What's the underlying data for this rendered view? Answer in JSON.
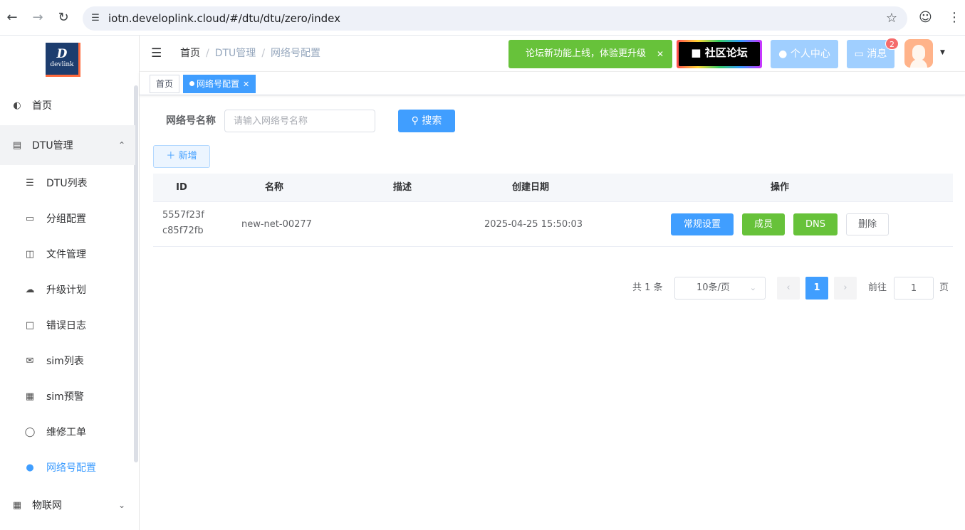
{
  "browser": {
    "url": "iotn.developlink.cloud/#/dtu/dtu/zero/index"
  },
  "logo": {
    "letter": "D",
    "text": "devlink"
  },
  "sidebar": {
    "items": [
      {
        "label": "首页",
        "icon": "dashboard-icon"
      },
      {
        "label": "DTU管理",
        "icon": "server-icon",
        "expanded": true
      },
      {
        "label": "DTU列表",
        "icon": "list-icon"
      },
      {
        "label": "分组配置",
        "icon": "monitor-icon"
      },
      {
        "label": "文件管理",
        "icon": "columns-icon"
      },
      {
        "label": "升级计划",
        "icon": "cloud-upload-icon"
      },
      {
        "label": "错误日志",
        "icon": "log-icon"
      },
      {
        "label": "sim列表",
        "icon": "mail-icon"
      },
      {
        "label": "sim预警",
        "icon": "chart-icon"
      },
      {
        "label": "维修工单",
        "icon": "shield-icon"
      },
      {
        "label": "网络号配置",
        "icon": "user-icon",
        "active": true
      },
      {
        "label": "物联网",
        "icon": "grid-icon"
      }
    ]
  },
  "header": {
    "breadcrumb": [
      "首页",
      "DTU管理",
      "网络号配置"
    ],
    "notice": "论坛新功能上线，体验更升级",
    "forum_label": "社区论坛",
    "profile_label": "个人中心",
    "messages_label": "消息",
    "messages_count": "2"
  },
  "tags": [
    {
      "label": "首页"
    },
    {
      "label": "网络号配置",
      "active": true
    }
  ],
  "search": {
    "label": "网络号名称",
    "placeholder": "请输入网络号名称",
    "button": "搜索"
  },
  "add_button": "新增",
  "table": {
    "columns": [
      "ID",
      "名称",
      "描述",
      "创建日期",
      "操作"
    ],
    "rows": [
      {
        "id_line1": "5557f23f",
        "id_line2": "c85f72fb",
        "name": "new-net-00277",
        "desc": "",
        "created": "2025-04-25 15:50:03",
        "actions": [
          "常规设置",
          "成员",
          "DNS",
          "删除"
        ]
      }
    ]
  },
  "pagination": {
    "total": "共 1 条",
    "page_size": "10条/页",
    "current_page": "1",
    "goto_label": "前往",
    "goto_value": "1",
    "page_unit": "页"
  },
  "colors": {
    "primary": "#409eff",
    "success": "#67c23a",
    "danger": "#f56c6c"
  }
}
